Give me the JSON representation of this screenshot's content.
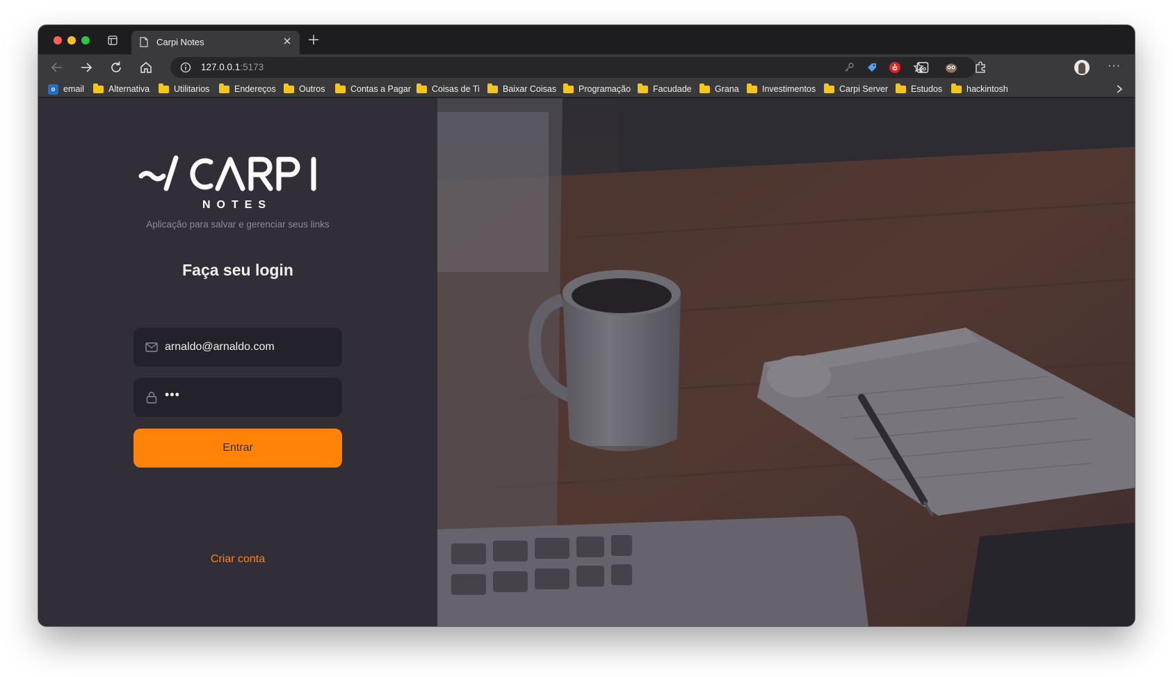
{
  "browser": {
    "tab": {
      "title": "Carpi Notes"
    },
    "address": {
      "host": "127.0.0.1",
      "port": ":5173"
    },
    "bookmarks": [
      {
        "label": "email",
        "icon": "outlook-icon"
      },
      {
        "label": "Alternativa",
        "icon": "folder-icon"
      },
      {
        "label": "Utilitarios",
        "icon": "folder-icon"
      },
      {
        "label": "Endereços",
        "icon": "folder-icon"
      },
      {
        "label": "Outros",
        "icon": "folder-icon"
      },
      {
        "label": "Contas a Pagar",
        "icon": "folder-icon"
      },
      {
        "label": "Coisas de Ti",
        "icon": "folder-icon"
      },
      {
        "label": "Baixar Coisas",
        "icon": "folder-icon"
      },
      {
        "label": "Programação",
        "icon": "folder-icon"
      },
      {
        "label": "Facudade",
        "icon": "folder-icon"
      },
      {
        "label": "Grana",
        "icon": "folder-icon"
      },
      {
        "label": "Investimentos",
        "icon": "folder-icon"
      },
      {
        "label": "Carpi Server",
        "icon": "folder-icon"
      },
      {
        "label": "Estudos",
        "icon": "folder-icon"
      },
      {
        "label": "hackintosh",
        "icon": "folder-icon"
      }
    ],
    "more_label": "···"
  },
  "page": {
    "logo": {
      "main": "~/CARPI",
      "sub": "NOTES"
    },
    "subtitle": "Aplicação para salvar e gerenciar seus links",
    "login_title": "Faça seu login",
    "email_field": {
      "value": "arnaldo@arnaldo.com"
    },
    "password_field": {
      "masked_value": "•••"
    },
    "submit_label": "Entrar",
    "create_account_label": "Criar conta"
  },
  "colors": {
    "accent": "#ff8307",
    "panel": "#312e38",
    "input_bg": "#232129",
    "text": "#f4ede8",
    "muted": "#8d8a94"
  }
}
